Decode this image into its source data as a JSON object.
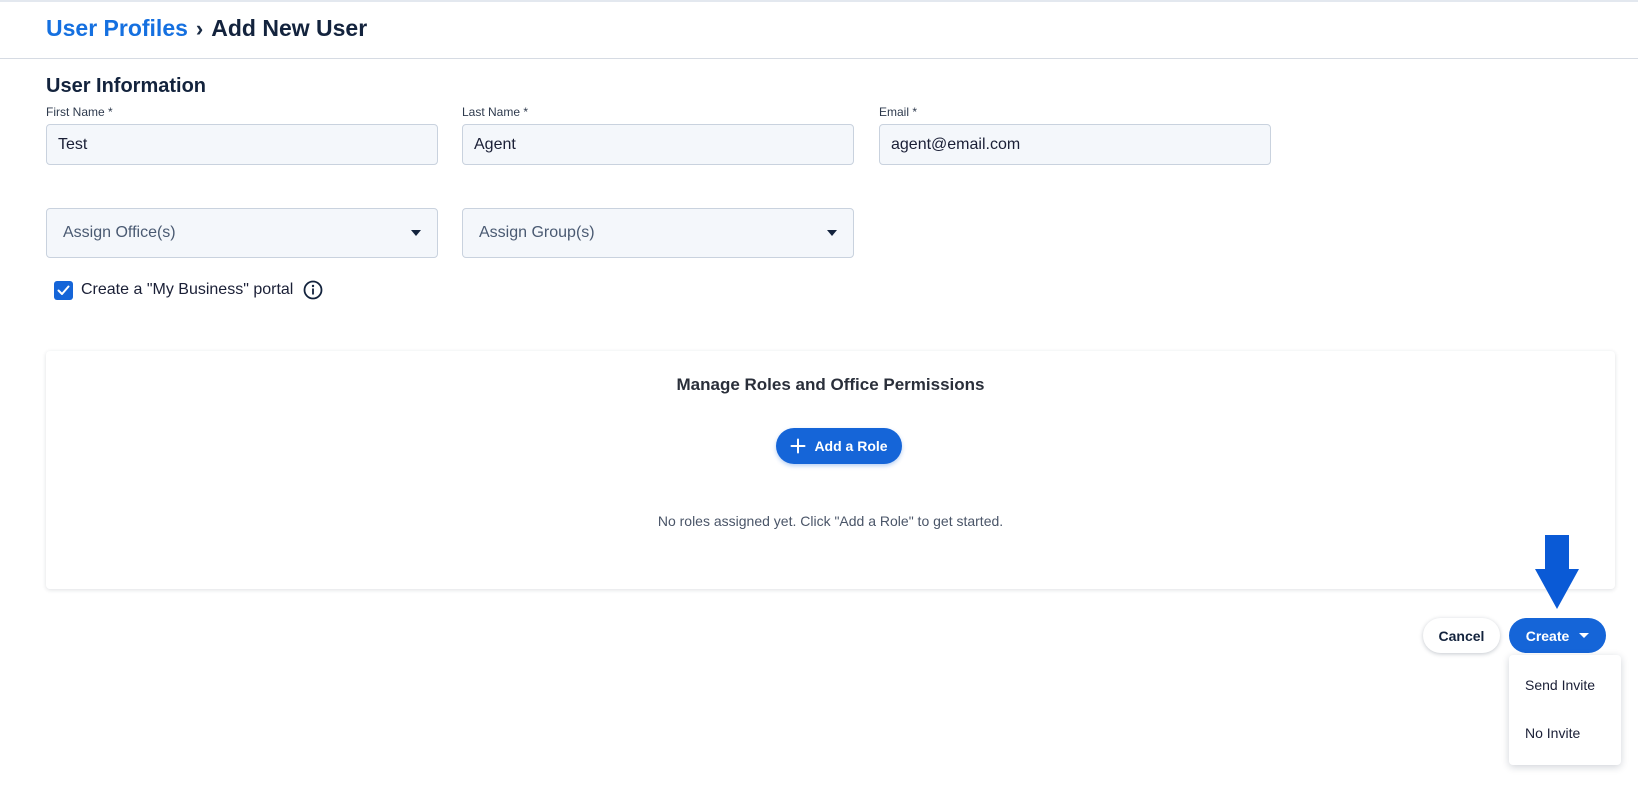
{
  "breadcrumb": {
    "parent": "User Profiles",
    "separator": "›",
    "current": "Add New User"
  },
  "user_info": {
    "title": "User Information",
    "first_name": {
      "label": "First Name *",
      "value": "Test"
    },
    "last_name": {
      "label": "Last Name *",
      "value": "Agent"
    },
    "email": {
      "label": "Email *",
      "value": "agent@email.com"
    }
  },
  "assign": {
    "offices_placeholder": "Assign Office(s)",
    "groups_placeholder": "Assign Group(s)"
  },
  "portal": {
    "checked": true,
    "label": "Create a \"My Business\" portal"
  },
  "roles": {
    "title": "Manage Roles and Office Permissions",
    "add_button": "Add a Role",
    "empty_text": "No roles assigned yet. Click \"Add a Role\" to get started."
  },
  "actions": {
    "cancel": "Cancel",
    "create": "Create",
    "menu": [
      "Send Invite",
      "No Invite"
    ]
  },
  "colors": {
    "primary": "#1565d8",
    "link": "#1570e0",
    "heading": "#13233d",
    "arrow": "#0a5ad6"
  },
  "icons": {
    "info": "info-circle-icon",
    "plus": "plus-icon",
    "check": "check-icon",
    "arrow": "arrow-down-icon"
  }
}
